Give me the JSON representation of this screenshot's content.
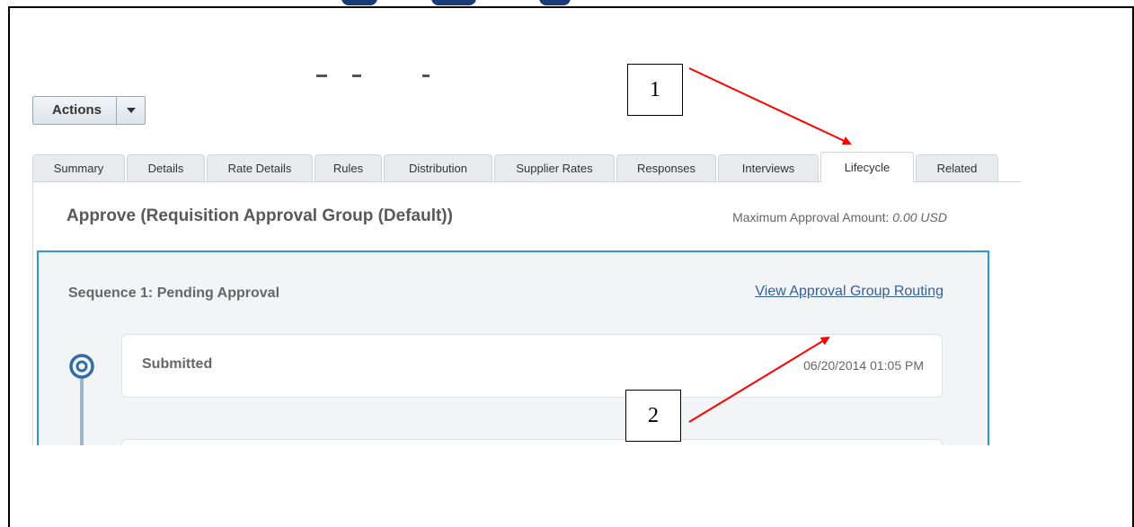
{
  "toolbar": {
    "actions_label": "Actions"
  },
  "tabs": [
    {
      "label": "Summary",
      "active": false
    },
    {
      "label": "Details",
      "active": false
    },
    {
      "label": "Rate Details",
      "active": false
    },
    {
      "label": "Rules",
      "active": false
    },
    {
      "label": "Distribution",
      "active": false
    },
    {
      "label": "Supplier Rates",
      "active": false
    },
    {
      "label": "Responses",
      "active": false
    },
    {
      "label": "Interviews",
      "active": false
    },
    {
      "label": "Lifecycle",
      "active": true
    },
    {
      "label": "Related",
      "active": false
    }
  ],
  "approval": {
    "title": "Approve (Requisition Approval Group (Default))",
    "max_amount_label": "Maximum Approval Amount: ",
    "max_amount_value": "0.00 USD"
  },
  "sequence": {
    "title": "Sequence 1: Pending Approval",
    "routing_link": "View Approval Group Routing",
    "steps": [
      {
        "label": "Submitted",
        "timestamp": "06/20/2014 01:05 PM",
        "icon": "radio-target-icon"
      }
    ]
  },
  "annotations": {
    "callout_1": "1",
    "callout_2": "2",
    "arrow_color": "#ff0000"
  },
  "colors": {
    "accent_blue": "#2f96d6",
    "link_blue": "#335f9a"
  }
}
